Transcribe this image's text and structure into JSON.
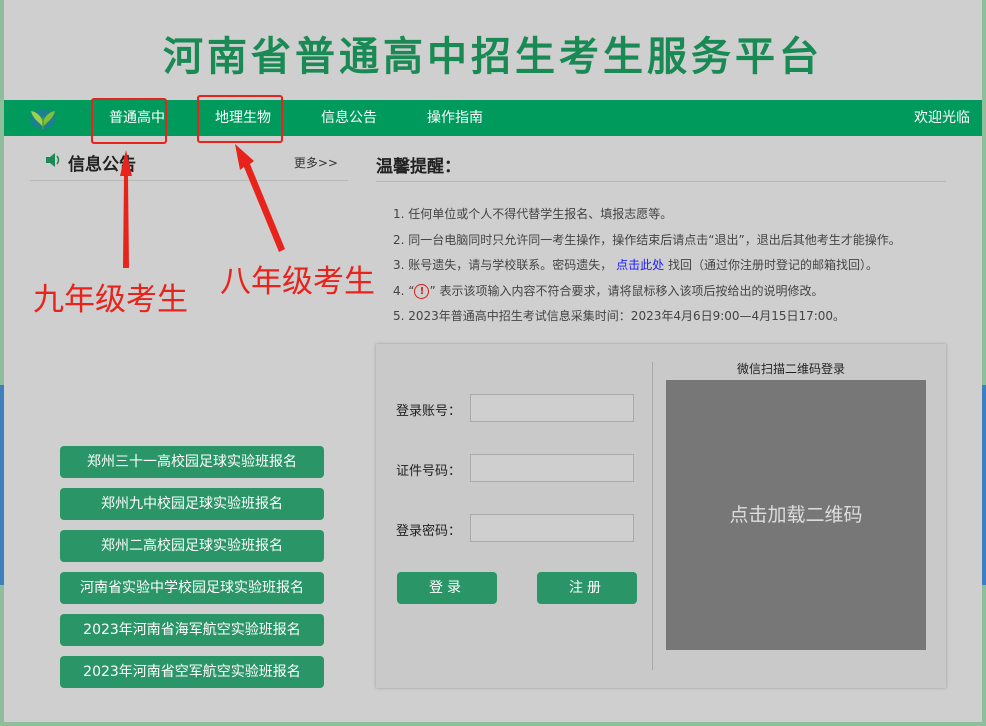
{
  "site_title": "河南省普通高中招生考生服务平台",
  "nav": {
    "items": [
      "普通高中",
      "地理生物",
      "信息公告",
      "操作指南"
    ],
    "welcome": "欢迎光临"
  },
  "annotations": {
    "grade9": "九年级考生",
    "grade8": "八年级考生"
  },
  "news": {
    "title": "信息公告",
    "more": "更多>>"
  },
  "tips": {
    "title": "温馨提醒：",
    "item1": "1. 任何单位或个人不得代替学生报名、填报志愿等。",
    "item2": "2. 同一台电脑同时只允许同一考生操作，操作结束后请点击“退出”，退出后其他考生才能操作。",
    "item3_pre": "3. 账号遗失，请与学校联系。密码遗失，",
    "item3_link": "点击此处",
    "item3_post": "找回（通过你注册时登记的邮箱找回）。",
    "item4_pre": "4. “",
    "item4_icon": "!",
    "item4_post": "” 表示该项输入内容不符合要求，请将鼠标移入该项后按给出的说明修改。",
    "item5": "5. 2023年普通高中招生考试信息采集时间：2023年4月6日9:00—4月15日17:00。"
  },
  "side_buttons": [
    "郑州三十一高校园足球实验班报名",
    "郑州九中校园足球实验班报名",
    "郑州二高校园足球实验班报名",
    "河南省实验中学校园足球实验班报名",
    "2023年河南省海军航空实验班报名",
    "2023年河南省空军航空实验班报名"
  ],
  "login": {
    "account_label": "登录账号：",
    "account_value": "",
    "id_label": "证件号码：",
    "id_value": "",
    "password_label": "登录密码：",
    "password_value": "",
    "login_button": "登录",
    "register_button": "注册",
    "qr_title": "微信扫描二维码登录",
    "qr_placeholder": "点击加载二维码"
  },
  "icons": {
    "logo": "leaf-logo-icon",
    "speaker": "speaker-icon",
    "warning": "warning-circle-icon"
  },
  "colors": {
    "brand_green": "#009a5d",
    "title_green": "#1a8a55",
    "button_green": "#2a9566",
    "annotation_red": "#e8231c",
    "link_blue": "#1a1aff",
    "page_gray": "#cfcfcf"
  }
}
